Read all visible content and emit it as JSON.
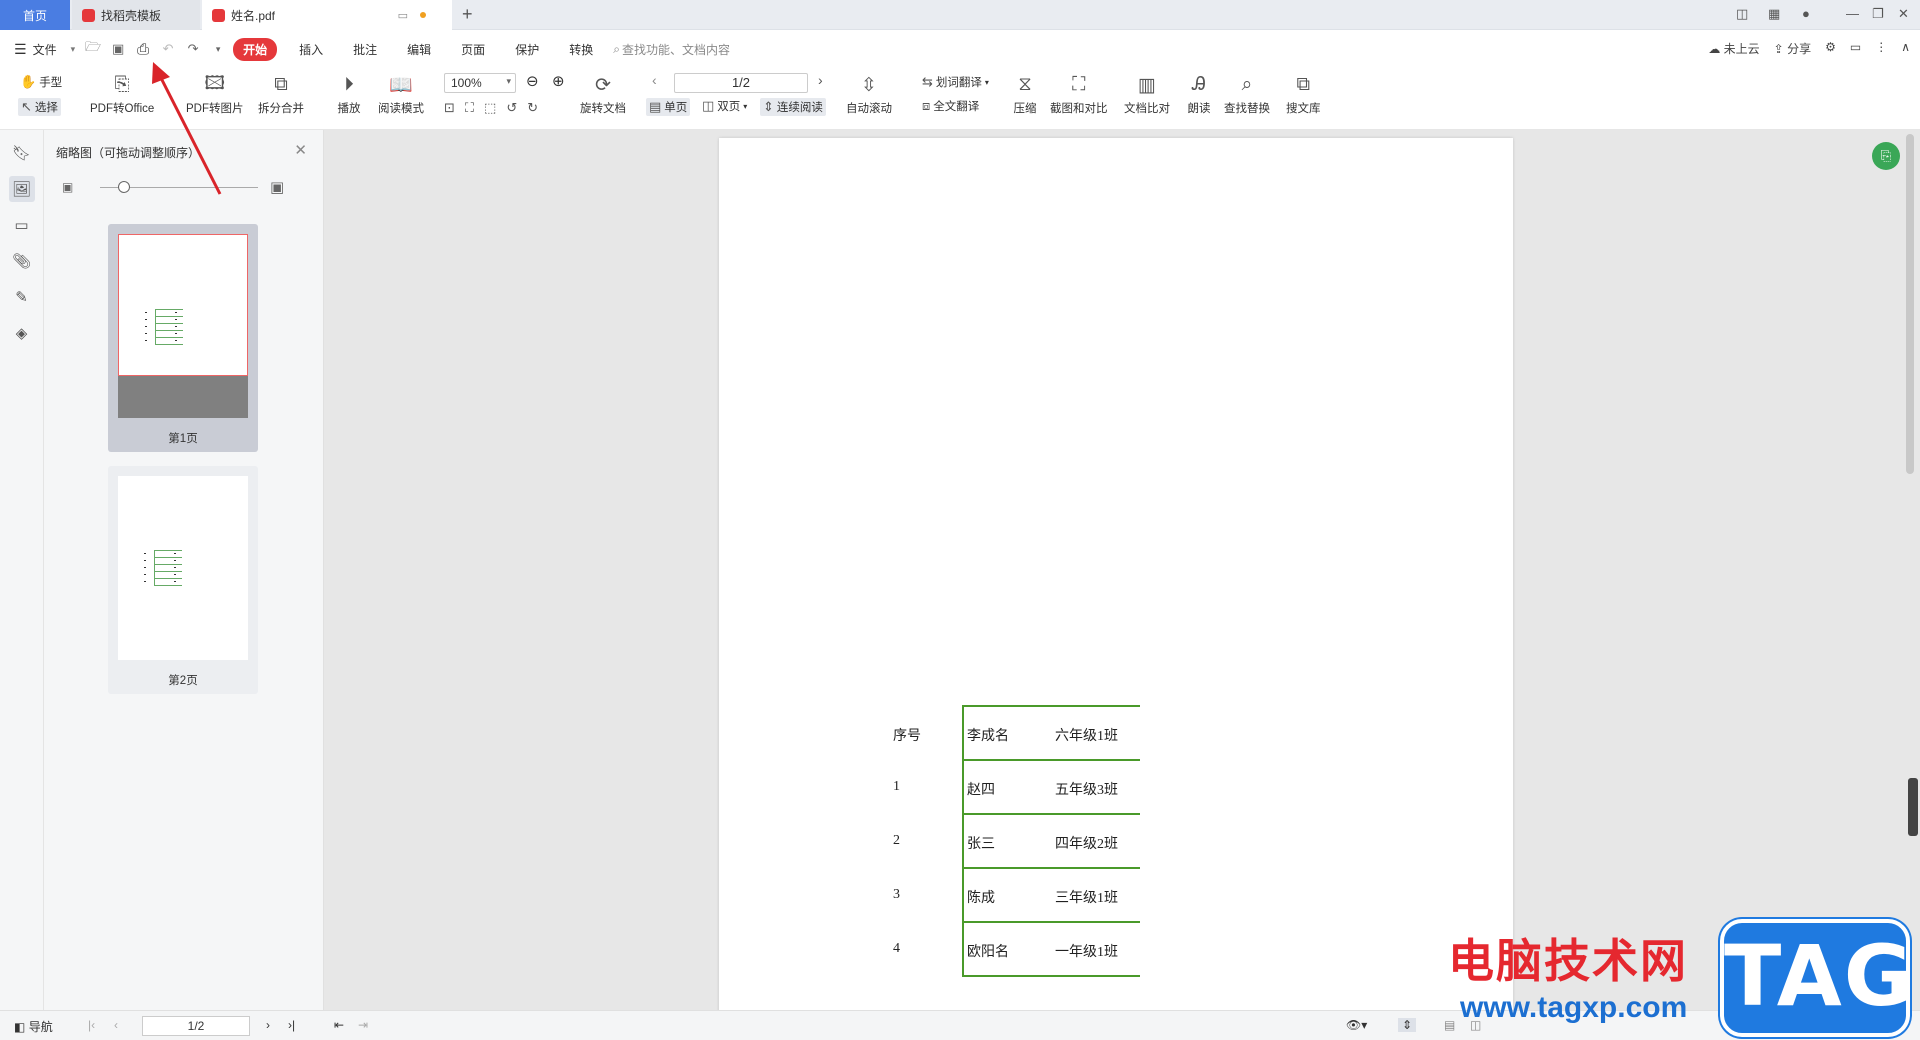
{
  "tabs": {
    "home": "首页",
    "template": "找稻壳模板",
    "file": "姓名.pdf"
  },
  "menu": {
    "file": "文件",
    "start": "开始",
    "items": [
      "插入",
      "批注",
      "编辑",
      "页面",
      "保护",
      "转换"
    ],
    "search_placeholder": "查找功能、文档内容",
    "cloud": "未上云",
    "share": "分享"
  },
  "ribbon": {
    "hand": "手型",
    "select": "选择",
    "pdf_to_office": "PDF转Office",
    "pdf_to_image": "PDF转图片",
    "split_merge": "拆分合并",
    "play": "播放",
    "read_mode": "阅读模式",
    "zoom": "100%",
    "rotate": "旋转文档",
    "page_input": "1/2",
    "single": "单页",
    "double": "双页",
    "continuous": "连续阅读",
    "auto_scroll": "自动滚动",
    "word_translate": "划词翻译",
    "full_translate": "全文翻译",
    "compress": "压缩",
    "screenshot_compare": "截图和对比",
    "doc_compare": "文档比对",
    "read_aloud": "朗读",
    "find_replace": "查找替换",
    "doc_library": "搜文库"
  },
  "thumbnail_panel": {
    "title": "缩略图（可拖动调整顺序）",
    "pages": [
      {
        "label": "第1页"
      },
      {
        "label": "第2页"
      }
    ]
  },
  "document": {
    "rows": [
      {
        "c1": "序号",
        "c2": "李成名",
        "c3": "六年级1班"
      },
      {
        "c1": "1",
        "c2": "赵四",
        "c3": "五年级3班"
      },
      {
        "c1": "2",
        "c2": "张三",
        "c3": "四年级2班"
      },
      {
        "c1": "3",
        "c2": "陈成",
        "c3": "三年级1班"
      },
      {
        "c1": "4",
        "c2": "欧阳名",
        "c3": "一年级1班"
      }
    ]
  },
  "statusbar": {
    "nav": "导航",
    "page": "1/2"
  },
  "watermark": {
    "title": "电脑技术网",
    "url": "www.tagxp.com",
    "logo": "TAG"
  },
  "colors": {
    "accent": "#e5383b",
    "tab_active": "#4a7de2",
    "table_line": "#4a9a2a",
    "arrow": "#d9242a"
  }
}
